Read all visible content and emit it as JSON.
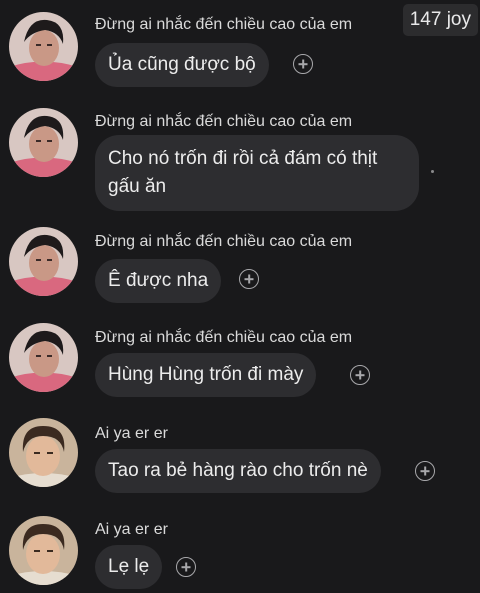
{
  "badge": "147 joy",
  "messages": [
    {
      "sender": "Đừng ai nhắc đến chiều cao của em",
      "text": "Ủa cũng được bộ",
      "avatar": "avatar-boy-pink"
    },
    {
      "sender": "Đừng ai nhắc đến chiều cao của em",
      "text": "Cho nó trốn đi rồi cả đám có thịt gấu ăn",
      "avatar": "avatar-boy-pink"
    },
    {
      "sender": "Đừng ai nhắc đến chiều cao của em",
      "text": "Ê được nha",
      "avatar": "avatar-boy-pink"
    },
    {
      "sender": "Đừng ai nhắc đến chiều cao của em",
      "text": "Hùng Hùng trốn đi mày",
      "avatar": "avatar-boy-pink"
    },
    {
      "sender": "Ai ya er er",
      "text": "Tao ra bẻ hàng rào cho trốn nè",
      "avatar": "avatar-boy-curly"
    },
    {
      "sender": "Ai ya er er",
      "text": "Lẹ lẹ",
      "avatar": "avatar-boy-curly"
    }
  ],
  "icons": {
    "react": "add-reaction-icon",
    "seen": "seen-dot-icon"
  },
  "colors": {
    "background": "#19191b",
    "bubble": "#2d2d30",
    "text": "#ececec"
  }
}
